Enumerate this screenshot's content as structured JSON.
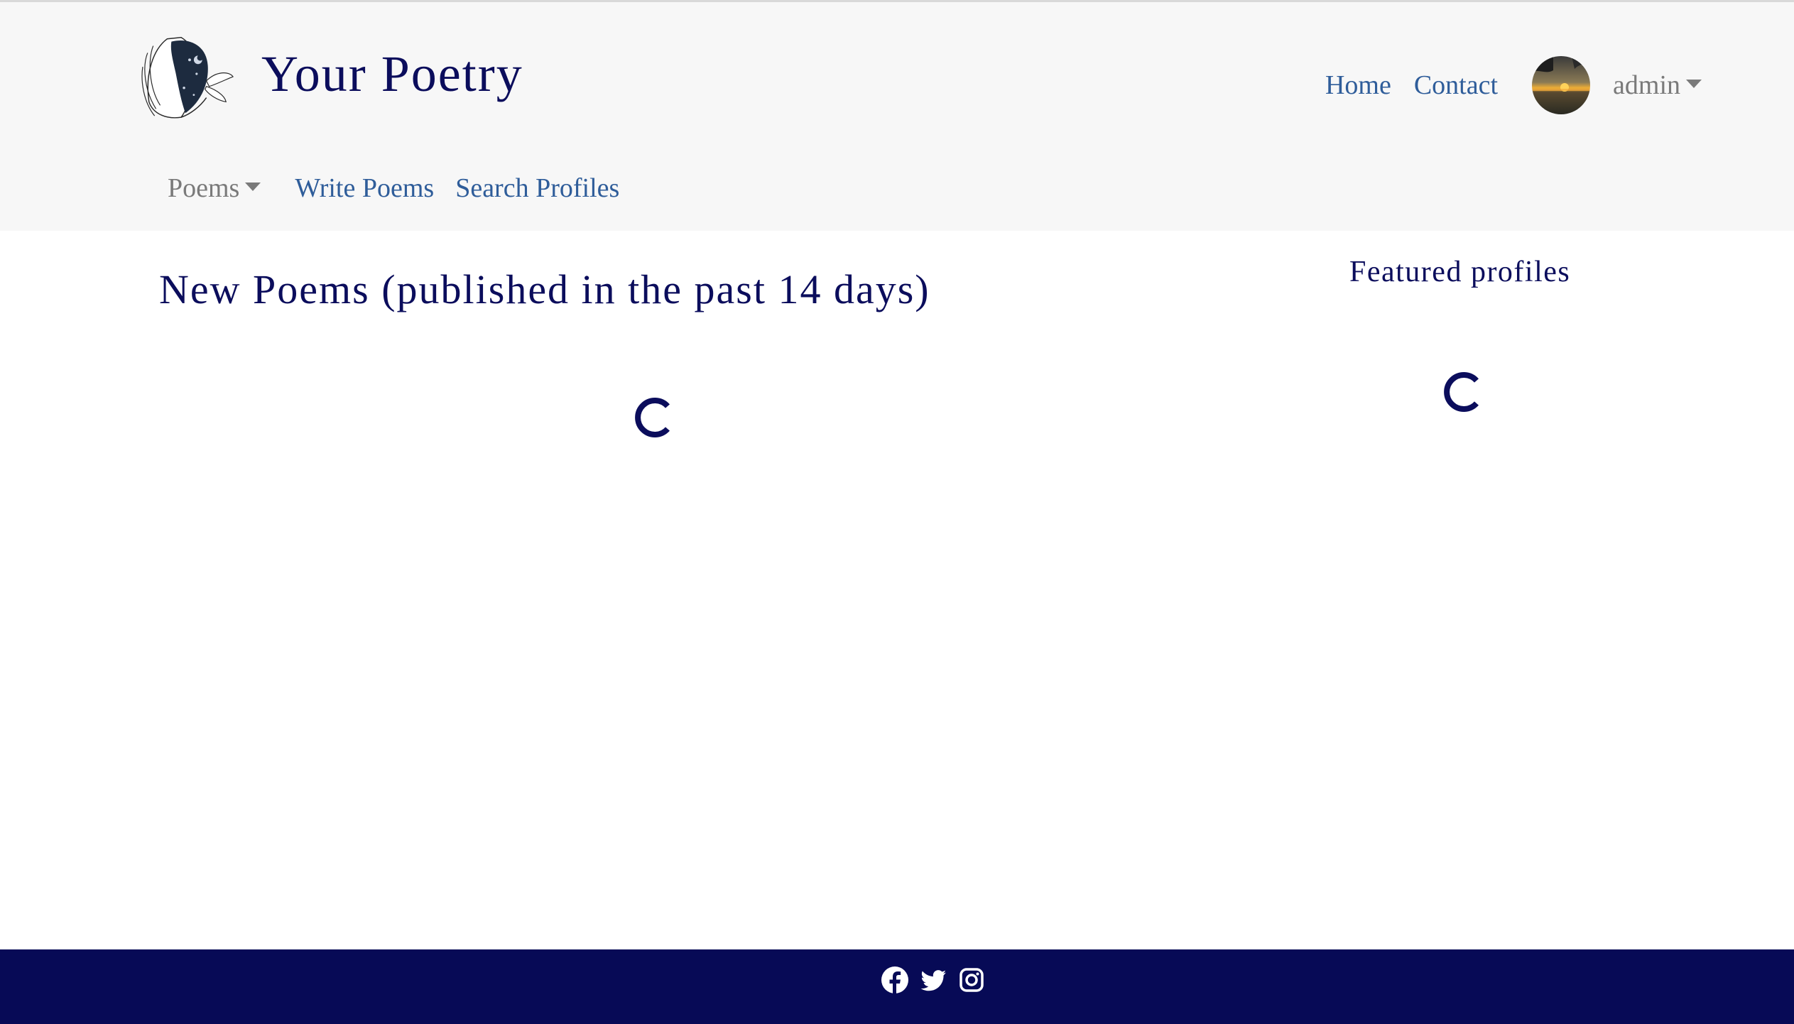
{
  "header": {
    "brand_title": "Your Poetry",
    "nav": {
      "home_label": "Home",
      "contact_label": "Contact",
      "user_label": "admin"
    },
    "subnav": {
      "poems_label": "Poems",
      "write_label": "Write Poems",
      "search_label": "Search Profiles"
    }
  },
  "main": {
    "new_poems_title": "New Poems (published in the past 14 days)",
    "featured_title": "Featured profiles"
  },
  "footer": {
    "icons": [
      "facebook-icon",
      "twitter-icon",
      "instagram-icon"
    ]
  },
  "colors": {
    "brand_navy": "#0b0d5c",
    "link_blue": "#2f5d9a",
    "muted_gray": "#7a7a7a",
    "header_bg": "#f7f7f7",
    "footer_bg": "#070a56"
  }
}
